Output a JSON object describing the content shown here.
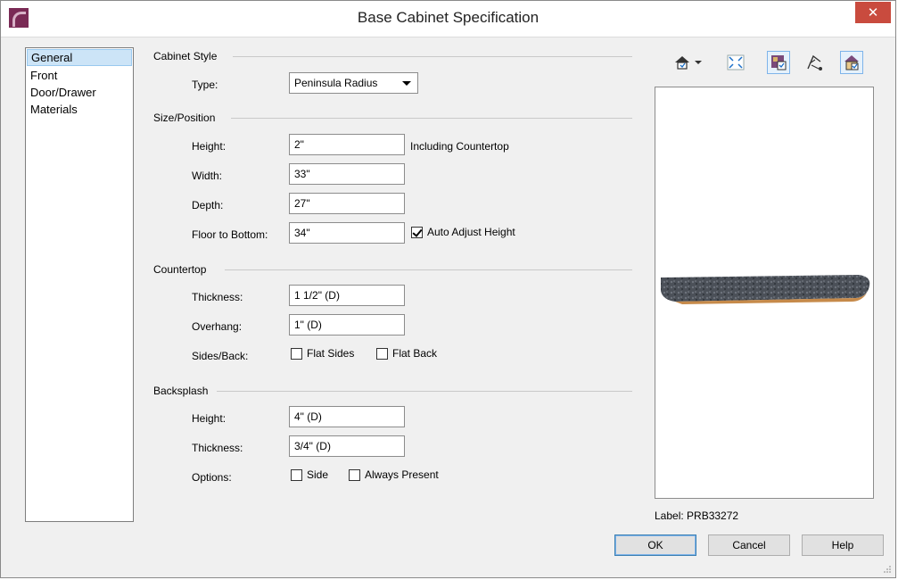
{
  "window": {
    "title": "Base Cabinet Specification",
    "close_glyph": "✕"
  },
  "nav": {
    "items": [
      {
        "label": "General",
        "selected": true
      },
      {
        "label": "Front",
        "selected": false
      },
      {
        "label": "Door/Drawer",
        "selected": false
      },
      {
        "label": "Materials",
        "selected": false
      }
    ]
  },
  "cabinet_style": {
    "heading": "Cabinet Style",
    "type_label": "Type:",
    "type_value": "Peninsula Radius"
  },
  "size_position": {
    "heading": "Size/Position",
    "height_label": "Height:",
    "height_value": "2\"",
    "height_note": "Including Countertop",
    "width_label": "Width:",
    "width_value": "33\"",
    "depth_label": "Depth:",
    "depth_value": "27\"",
    "floor_label": "Floor to Bottom:",
    "floor_value": "34\"",
    "auto_adjust_label": "Auto Adjust Height",
    "auto_adjust_checked": true
  },
  "countertop": {
    "heading": "Countertop",
    "thickness_label": "Thickness:",
    "thickness_value": "1 1/2\" (D)",
    "overhang_label": "Overhang:",
    "overhang_value": "1\" (D)",
    "sides_back_label": "Sides/Back:",
    "flat_sides_label": "Flat Sides",
    "flat_sides_checked": false,
    "flat_back_label": "Flat Back",
    "flat_back_checked": false
  },
  "backsplash": {
    "heading": "Backsplash",
    "height_label": "Height:",
    "height_value": "4\" (D)",
    "thickness_label": "Thickness:",
    "thickness_value": "3/4\" (D)",
    "options_label": "Options:",
    "side_label": "Side",
    "side_checked": false,
    "always_present_label": "Always Present",
    "always_present_checked": false
  },
  "preview": {
    "toolbar_icons": [
      "camera-view-icon",
      "fit-view-icon",
      "show-materials-icon",
      "orbit-icon",
      "show-label-icon"
    ],
    "label": "Label:  PRB33272"
  },
  "buttons": {
    "ok": "OK",
    "cancel": "Cancel",
    "help": "Help"
  },
  "colors": {
    "title_close": "#c94b3e",
    "selection": "#cce4f7",
    "countertop_stone": "#4b5058",
    "countertop_edge": "#c68a4a"
  }
}
